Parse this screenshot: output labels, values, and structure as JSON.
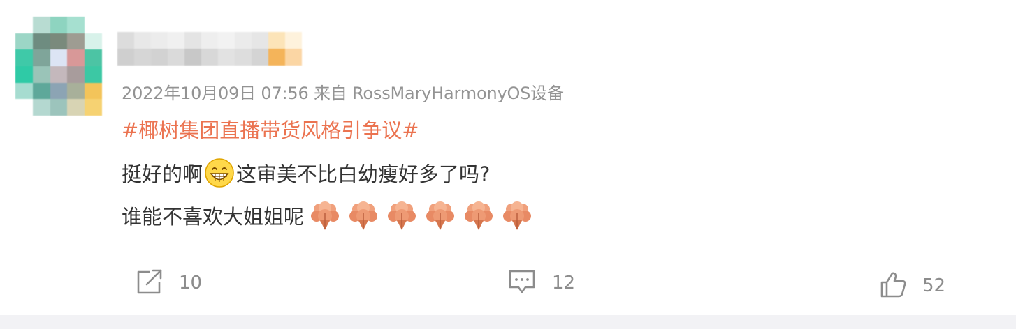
{
  "post": {
    "meta": "2022年10月09日 07:56  来自 RossMaryHarmonyOS设备",
    "hashtag": "#椰树集团直播带货风格引争议#",
    "text_line1_a": "挺好的啊",
    "text_line1_b": "这审美不比白幼瘦好多了吗?",
    "text_line2": "谁能不喜欢大姐姐呢",
    "emoji_line1": "grinning-face-icon",
    "emoji_line2": [
      "flower-emoji-icon",
      "flower-emoji-icon",
      "flower-emoji-icon",
      "flower-emoji-icon",
      "flower-emoji-icon",
      "flower-emoji-icon"
    ]
  },
  "actions": {
    "forward": {
      "icon": "share-icon",
      "count": "10"
    },
    "comment": {
      "icon": "comment-icon",
      "count": "12"
    },
    "like": {
      "icon": "thumbs-up-icon",
      "count": "52"
    }
  },
  "colors": {
    "hashtag": "#eb7350",
    "meta": "#939393",
    "body_text": "#333333",
    "bottom_bar": "#f2f2f5"
  }
}
